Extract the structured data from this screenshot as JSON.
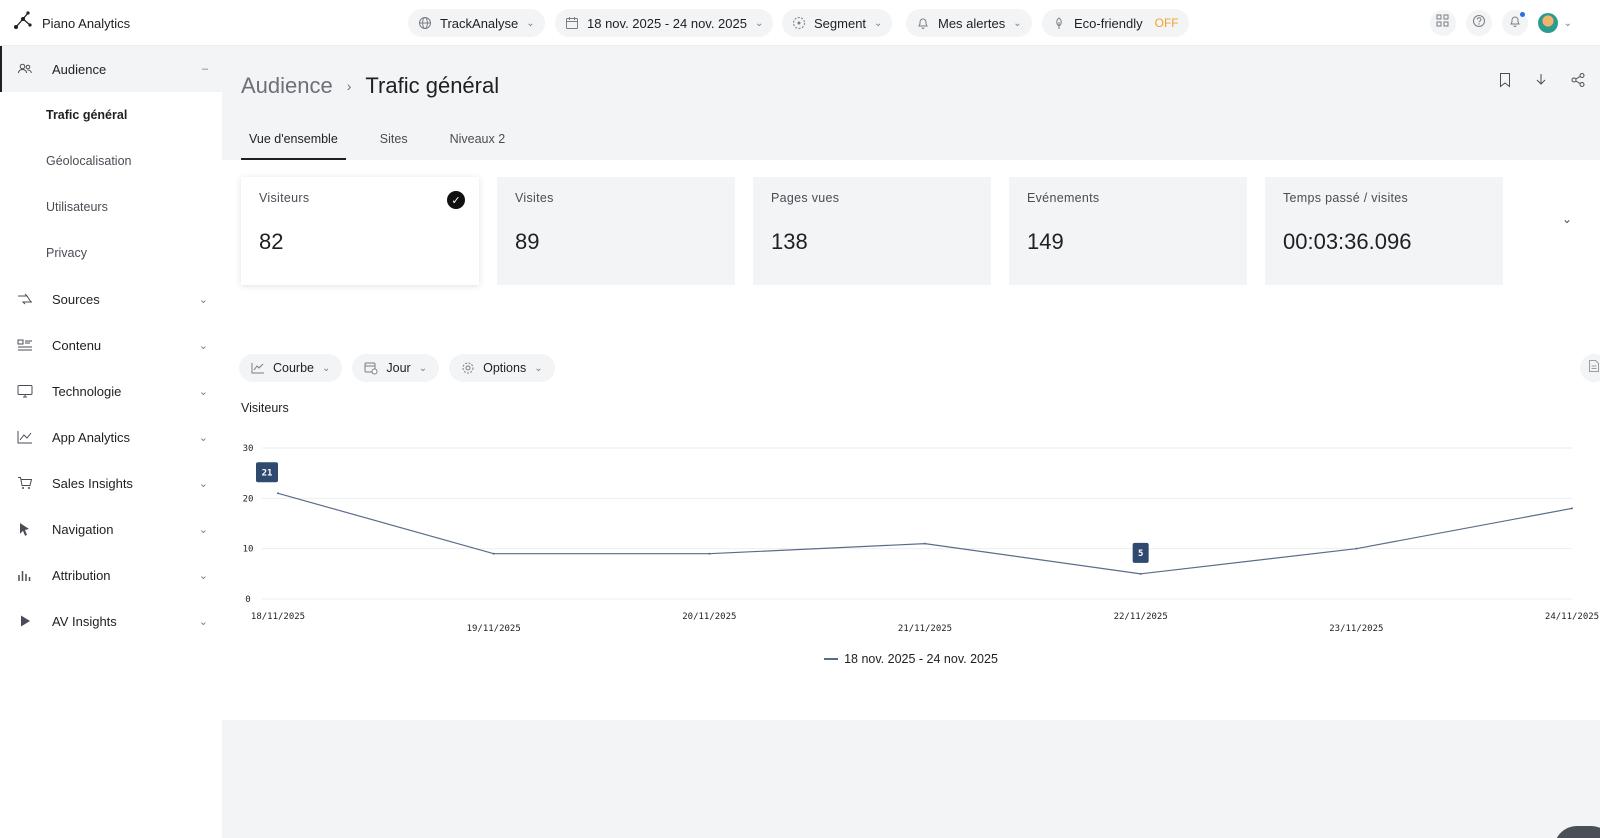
{
  "app": {
    "name": "Piano Analytics"
  },
  "topbar": {
    "site": "TrackAnalyse",
    "date_range": "18 nov. 2025 - 24 nov. 2025",
    "segment": "Segment",
    "alerts": "Mes alertes",
    "eco_label": "Eco-friendly",
    "eco_status": "OFF"
  },
  "sidebar": {
    "sections": [
      {
        "label": "Audience",
        "icon": "users-icon",
        "expanded": true
      },
      {
        "label": "Sources",
        "icon": "sources-icon"
      },
      {
        "label": "Contenu",
        "icon": "content-icon"
      },
      {
        "label": "Technologie",
        "icon": "monitor-icon"
      },
      {
        "label": "App Analytics",
        "icon": "line-chart-icon"
      },
      {
        "label": "Sales Insights",
        "icon": "cart-icon"
      },
      {
        "label": "Navigation",
        "icon": "cursor-icon"
      },
      {
        "label": "Attribution",
        "icon": "bars-icon"
      },
      {
        "label": "AV Insights",
        "icon": "play-icon"
      }
    ],
    "audience_children": [
      "Trafic général",
      "Géolocalisation",
      "Utilisateurs",
      "Privacy"
    ]
  },
  "page": {
    "breadcrumb_parent": "Audience",
    "title": "Trafic général",
    "tabs": [
      "Vue d'ensemble",
      "Sites",
      "Niveaux 2"
    ]
  },
  "kpis": [
    {
      "label": "Visiteurs",
      "value": "82",
      "selected": true
    },
    {
      "label": "Visites",
      "value": "89"
    },
    {
      "label": "Pages vues",
      "value": "138"
    },
    {
      "label": "Evénements",
      "value": "149"
    },
    {
      "label": "Temps passé / visites",
      "value": "00:03:36.096"
    }
  ],
  "toolbar": {
    "chart_type": "Courbe",
    "period": "Jour",
    "options": "Options"
  },
  "chart_data": {
    "type": "line",
    "title": "Visiteurs",
    "categories": [
      "18/11/2025",
      "19/11/2025",
      "20/11/2025",
      "21/11/2025",
      "22/11/2025",
      "23/11/2025",
      "24/11/2025"
    ],
    "series": [
      {
        "name": "18 nov. 2025 - 24 nov. 2025",
        "values": [
          21,
          9,
          9,
          11,
          5,
          10,
          18
        ]
      }
    ],
    "ylim": [
      0,
      30
    ],
    "yticks": [
      0,
      10,
      20,
      30
    ],
    "data_labels": [
      {
        "x": "18/11/2025",
        "value": "21"
      },
      {
        "x": "22/11/2025",
        "value": "5"
      }
    ],
    "grid": true,
    "legend": "bottom-center",
    "line_color": "#5b6c8a",
    "label_color": "#2f4a6e"
  },
  "colors": {
    "accent_off": "#f0a32b",
    "active_border": "#1f1f24"
  }
}
